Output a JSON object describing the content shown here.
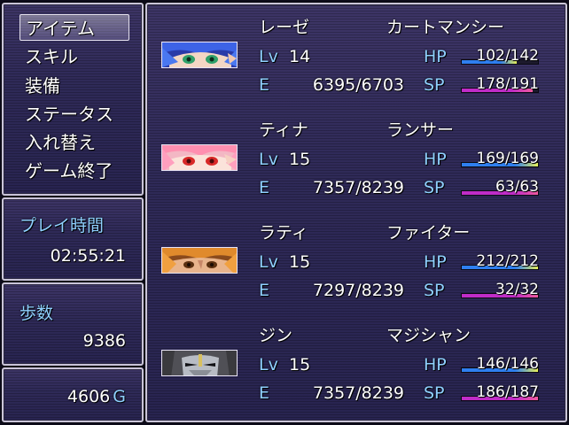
{
  "menu": {
    "items": [
      {
        "label": "アイテム"
      },
      {
        "label": "スキル"
      },
      {
        "label": "装備"
      },
      {
        "label": "ステータス"
      },
      {
        "label": "入れ替え"
      },
      {
        "label": "ゲーム終了"
      }
    ],
    "selected_index": 0
  },
  "playtime": {
    "label": "プレイ時間",
    "value": "02:55:21"
  },
  "steps": {
    "label": "歩数",
    "value": "9386"
  },
  "gold": {
    "value": "4606",
    "unit": "G"
  },
  "labels": {
    "lv": "Lv",
    "exp": "E",
    "hp": "HP",
    "sp": "SP"
  },
  "colors": {
    "system_text": "#8fd0ff",
    "hp_gauge": "#2f7ff0",
    "hp_gauge_end": "#e8f05a",
    "sp_gauge": "#c02cc8",
    "sp_gauge_end": "#f05aa0"
  },
  "party": [
    {
      "name": "レーゼ",
      "class": "カートマンシー",
      "lv": "14",
      "exp": "6395/6703",
      "hp": "102/142",
      "hp_ratio": 0.718,
      "sp": "178/191",
      "sp_ratio": 0.932,
      "face_icon": "blue-haired-hero-portrait"
    },
    {
      "name": "ティナ",
      "class": "ランサー",
      "lv": "15",
      "exp": "7357/8239",
      "hp": "169/169",
      "hp_ratio": 1.0,
      "sp": "63/63",
      "sp_ratio": 1.0,
      "face_icon": "pink-haired-girl-portrait"
    },
    {
      "name": "ラティ",
      "class": "ファイター",
      "lv": "15",
      "exp": "7297/8239",
      "hp": "212/212",
      "hp_ratio": 1.0,
      "sp": "32/32",
      "sp_ratio": 1.0,
      "face_icon": "orange-haired-fighter-portrait"
    },
    {
      "name": "ジン",
      "class": "マジシャン",
      "lv": "15",
      "exp": "7357/8239",
      "hp": "146/146",
      "hp_ratio": 1.0,
      "sp": "186/187",
      "sp_ratio": 0.995,
      "face_icon": "masked-mage-portrait"
    }
  ]
}
